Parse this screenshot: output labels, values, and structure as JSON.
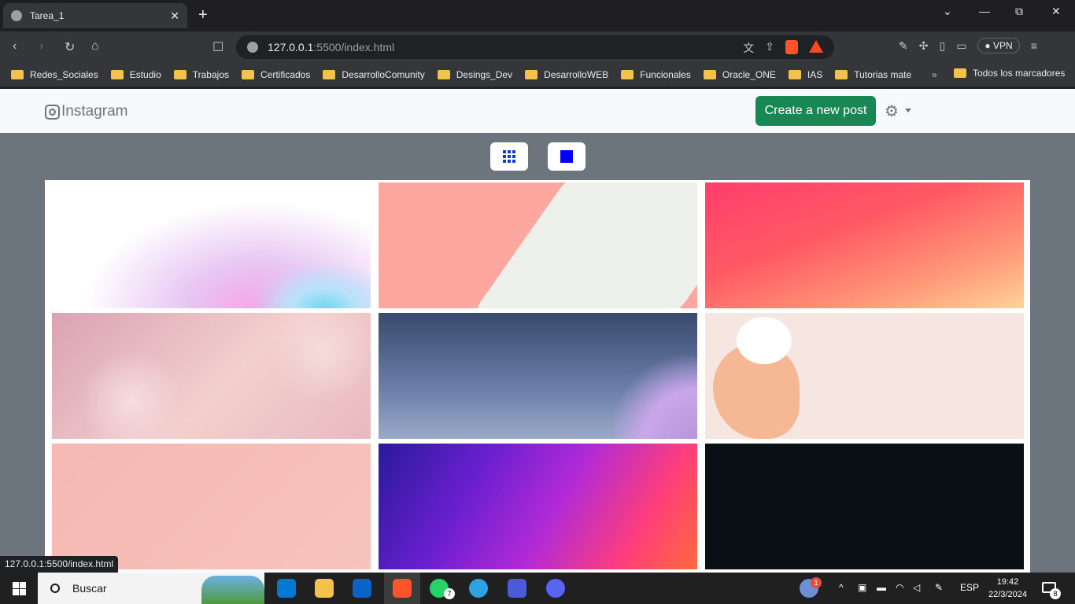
{
  "browser": {
    "tab_title": "Tarea_1",
    "tab_close": "✕",
    "new_tab": "+",
    "minimize": "⌄",
    "minimize_symbol": "—",
    "restore": "⧉",
    "close": "✕",
    "url_host": "127.0.0.1",
    "url_rest": ":5500/index.html",
    "vpn_label": "VPN",
    "bookmarks": [
      "Redes_Sociales",
      "Estudio",
      "Trabajos",
      "Certificados",
      "DesarrolloComunity",
      "Desings_Dev",
      "DesarrolloWEB",
      "Funcionales",
      "Oracle_ONE",
      "IAS",
      "Tutorias mate"
    ],
    "bookmarks_more": "»",
    "all_bookmarks": "Todos los marcadores",
    "status_url": "127.0.0.1:5500/index.html"
  },
  "page": {
    "brand": "Instagram",
    "create_button": "Create a new post",
    "view_grid": "grid-icon",
    "view_single": "square-icon",
    "images": [
      {
        "description": "white with pink and blue paint splash"
      },
      {
        "description": "peach with white torn shapes"
      },
      {
        "description": "pink-orange gradient"
      },
      {
        "description": "pink bokeh"
      },
      {
        "description": "blue gradient with purple flower"
      },
      {
        "description": "floral illustration with leaves"
      },
      {
        "description": "salmon pink texture"
      },
      {
        "description": "purple-orange gradient"
      },
      {
        "description": "dark black-green"
      }
    ],
    "colors": {
      "navbar_bg": "#f8f9fa",
      "page_bg": "#6c757d",
      "create_button_bg": "#198754",
      "view_icon": "#0000ff"
    }
  },
  "taskbar": {
    "search_label": "Buscar",
    "whatsapp_badge": "7",
    "weather_badge": "1",
    "language": "ESP",
    "time": "19:42",
    "date": "22/3/2024",
    "notifications": "8"
  }
}
